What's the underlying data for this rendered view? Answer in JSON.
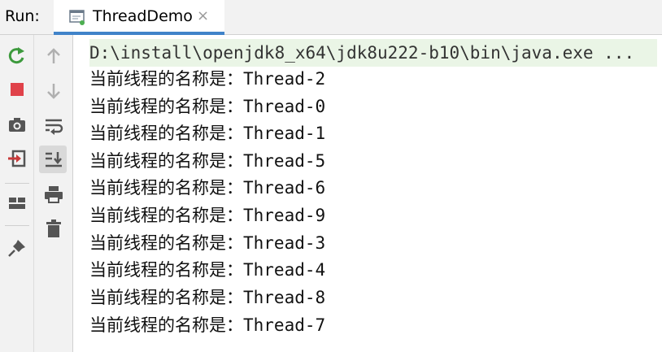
{
  "header": {
    "run_label": "Run:",
    "tab": {
      "title": "ThreadDemo",
      "close_glyph": "×",
      "icon": "console-app-icon"
    }
  },
  "toolbar_left": [
    {
      "icon": "rerun-icon",
      "color": "#3d9a3d"
    },
    {
      "icon": "stop-icon",
      "color": "#e0424a"
    },
    {
      "icon": "camera-icon",
      "color": "#555555"
    },
    {
      "icon": "exit-icon",
      "color": "#c83a3a"
    },
    {
      "icon": "layout-icon",
      "color": "#555555"
    },
    {
      "icon": "pin-icon",
      "color": "#555555"
    }
  ],
  "toolbar_right": [
    {
      "icon": "arrow-up-icon"
    },
    {
      "icon": "arrow-down-icon"
    },
    {
      "icon": "soft-wrap-icon"
    },
    {
      "icon": "scroll-to-end-icon",
      "active": true
    },
    {
      "icon": "print-icon"
    },
    {
      "icon": "trash-icon"
    }
  ],
  "console": {
    "command": "D:\\install\\openjdk8_x64\\jdk8u222-b10\\bin\\java.exe ...",
    "lines": [
      "当前线程的名称是：Thread-2",
      "当前线程的名称是：Thread-0",
      "当前线程的名称是：Thread-1",
      "当前线程的名称是：Thread-5",
      "当前线程的名称是：Thread-6",
      "当前线程的名称是：Thread-9",
      "当前线程的名称是：Thread-3",
      "当前线程的名称是：Thread-4",
      "当前线程的名称是：Thread-8",
      "当前线程的名称是：Thread-7"
    ]
  },
  "colors": {
    "accent": "#4083c9",
    "command_background": "#eaf5e6",
    "toolbar_background": "#f2f2f2"
  }
}
